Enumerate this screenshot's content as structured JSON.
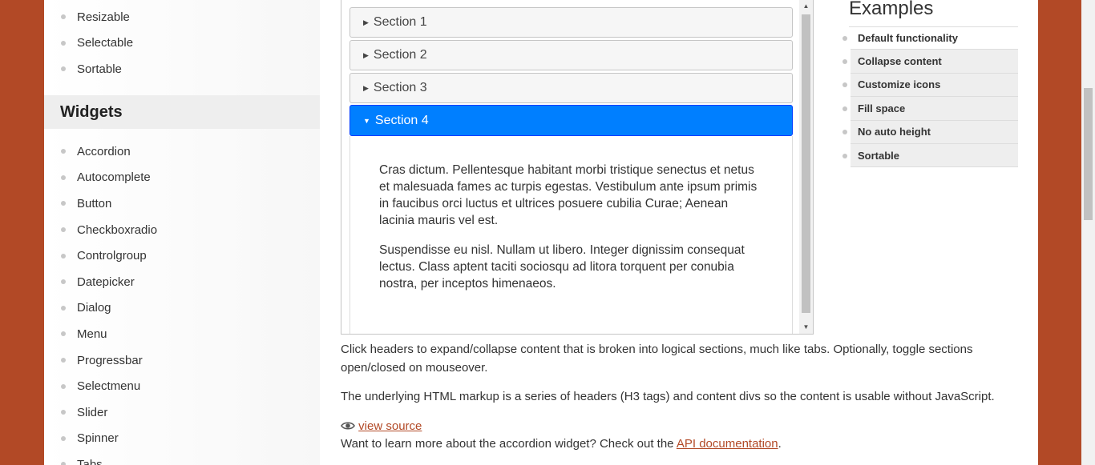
{
  "sidebar": {
    "top_items": [
      "Resizable",
      "Selectable",
      "Sortable"
    ],
    "widgets_heading": "Widgets",
    "widget_items": [
      "Accordion",
      "Autocomplete",
      "Button",
      "Checkboxradio",
      "Controlgroup",
      "Datepicker",
      "Dialog",
      "Menu",
      "Progressbar",
      "Selectmenu",
      "Slider",
      "Spinner",
      "Tabs"
    ]
  },
  "accordion": {
    "sections": [
      {
        "label": "Section 1",
        "active": false
      },
      {
        "label": "Section 2",
        "active": false
      },
      {
        "label": "Section 3",
        "active": false
      },
      {
        "label": "Section 4",
        "active": true
      }
    ],
    "content_paragraphs": [
      "Cras dictum. Pellentesque habitant morbi tristique senectus et netus et malesuada fames ac turpis egestas. Vestibulum ante ipsum primis in faucibus orci luctus et ultrices posuere cubilia Curae; Aenean lacinia mauris vel est.",
      "Suspendisse eu nisl. Nullam ut libero. Integer dignissim consequat lectus. Class aptent taciti sociosqu ad litora torquent per conubia nostra, per inceptos himenaeos."
    ]
  },
  "description": {
    "p1": "Click headers to expand/collapse content that is broken into logical sections, much like tabs. Optionally, toggle sections open/closed on mouseover.",
    "p2": "The underlying HTML markup is a series of headers (H3 tags) and content divs so the content is usable without JavaScript.",
    "view_source": "view source",
    "learn_more_prefix": "Want to learn more about the accordion widget? Check out the ",
    "learn_more_link": "API documentation",
    "learn_more_suffix": "."
  },
  "examples": {
    "title": "Examples",
    "items": [
      "Default functionality",
      "Collapse content",
      "Customize icons",
      "Fill space",
      "No auto height",
      "Sortable"
    ]
  },
  "colors": {
    "brand": "#b24926",
    "active_header": "#007fff"
  }
}
